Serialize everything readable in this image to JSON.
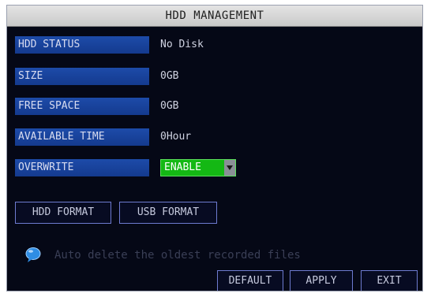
{
  "window": {
    "title": "HDD MANAGEMENT"
  },
  "fields": {
    "hdd_status": {
      "label": "HDD STATUS",
      "value": "No Disk"
    },
    "size": {
      "label": "SIZE",
      "value": "0GB"
    },
    "free_space": {
      "label": "FREE SPACE",
      "value": "0GB"
    },
    "available_time": {
      "label": "AVAILABLE TIME",
      "value": "0Hour"
    },
    "overwrite": {
      "label": "OVERWRITE",
      "value": "ENABLE"
    }
  },
  "buttons": {
    "hdd_format": "HDD FORMAT",
    "usb_format": "USB FORMAT",
    "default": "DEFAULT",
    "apply": "APPLY",
    "exit": "EXIT"
  },
  "hint": {
    "icon": "info-bubble-icon",
    "text": "Auto delete the oldest recorded files"
  },
  "colors": {
    "background": "#050816",
    "label_bg": "#1d4ba9",
    "select_bg": "#14b814",
    "button_border": "#6e7bd0",
    "title_bg": "#d6d6d6"
  }
}
